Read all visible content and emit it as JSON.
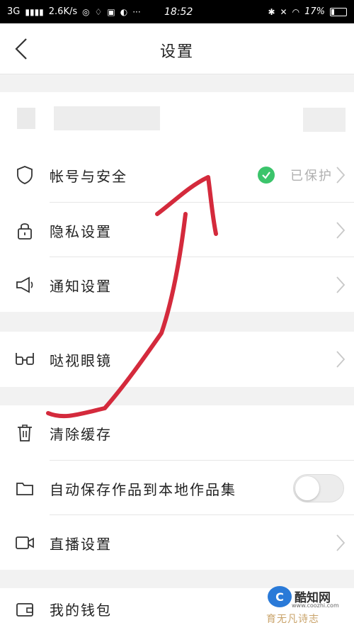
{
  "status_bar": {
    "network": "3G",
    "speed": "2.6K/s",
    "time": "18:52",
    "battery": "17%"
  },
  "nav": {
    "title": "设置"
  },
  "settings": {
    "account_security": {
      "label": "帐号与安全",
      "status": "已保护"
    },
    "privacy": {
      "label": "隐私设置"
    },
    "notifications": {
      "label": "通知设置"
    },
    "glasses": {
      "label": "哒视眼镜"
    },
    "clear_cache": {
      "label": "清除缓存"
    },
    "auto_save": {
      "label": "自动保存作品到本地作品集",
      "enabled": false
    },
    "live": {
      "label": "直播设置"
    },
    "wallet": {
      "label": "我的钱包"
    }
  },
  "watermark": {
    "brand": "酷知网",
    "url": "www.coozhi.com",
    "tagline": "育无凡诗志"
  },
  "colors": {
    "accent_green": "#3bc46b",
    "annotation_red": "#d42a3c"
  }
}
